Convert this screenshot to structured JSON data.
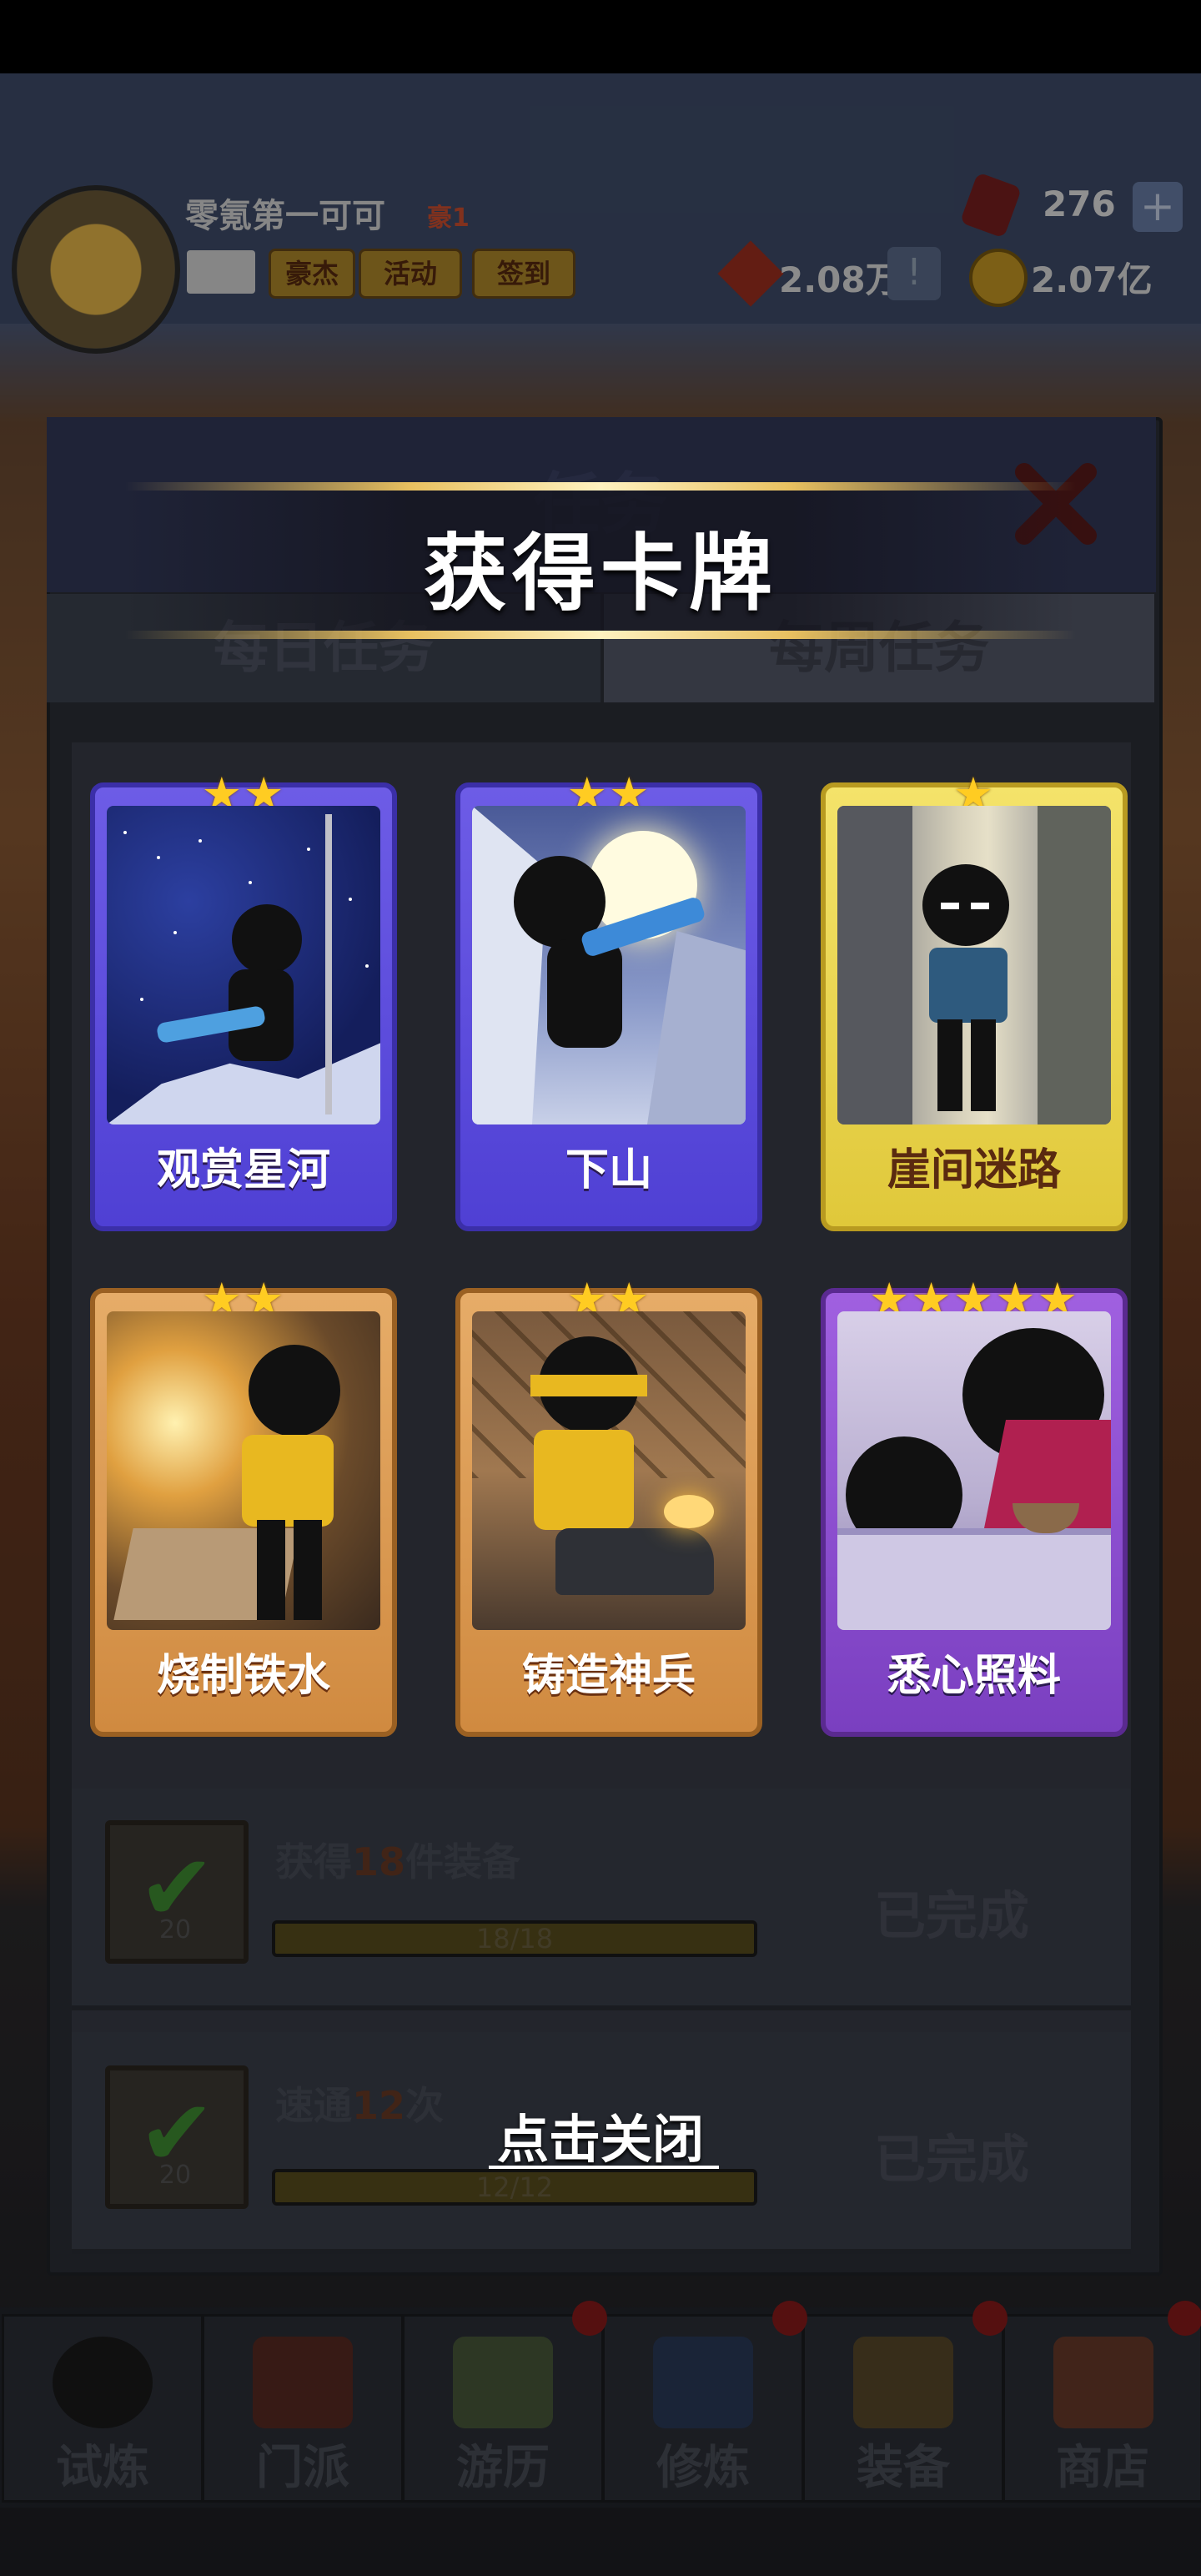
{
  "hud": {
    "player_name": "零氪第一可可",
    "vip_label": "豪1",
    "buttons": [
      "豪杰",
      "活动",
      "签到"
    ],
    "gems": "276",
    "power": "2.08万",
    "coins": "2.07亿"
  },
  "task_panel": {
    "title": "任务",
    "tabs": [
      "每日任务",
      "每周任务"
    ],
    "tasks": [
      {
        "prefix": "获得",
        "count": "18",
        "suffix": "件装备",
        "progress": "18/18",
        "reward": "20",
        "status": "已完成"
      },
      {
        "prefix": "速通",
        "count": "12",
        "suffix": "次",
        "progress": "12/12",
        "reward": "20",
        "status": "已完成"
      }
    ]
  },
  "popup": {
    "title": "获得卡牌",
    "close_hint": "点击关闭",
    "cards": [
      {
        "name": "观赏星河",
        "stars": "★★",
        "frame": "blue"
      },
      {
        "name": "下山",
        "stars": "★★",
        "frame": "blue"
      },
      {
        "name": "崖间迷路",
        "stars": "★",
        "frame": "yellow"
      },
      {
        "name": "烧制铁水",
        "stars": "★★",
        "frame": "orange"
      },
      {
        "name": "铸造神兵",
        "stars": "★★",
        "frame": "orange"
      },
      {
        "name": "悉心照料",
        "stars": "★★★★★",
        "frame": "purple"
      }
    ]
  },
  "bottom_nav": [
    "试炼",
    "门派",
    "游历",
    "修炼",
    "装备",
    "商店"
  ],
  "colors": {
    "star": "#ffcc22",
    "card_blue": "#5b4be0",
    "card_yellow": "#ecd648",
    "card_orange": "#dc9c54",
    "card_purple": "#8c4ed0"
  }
}
